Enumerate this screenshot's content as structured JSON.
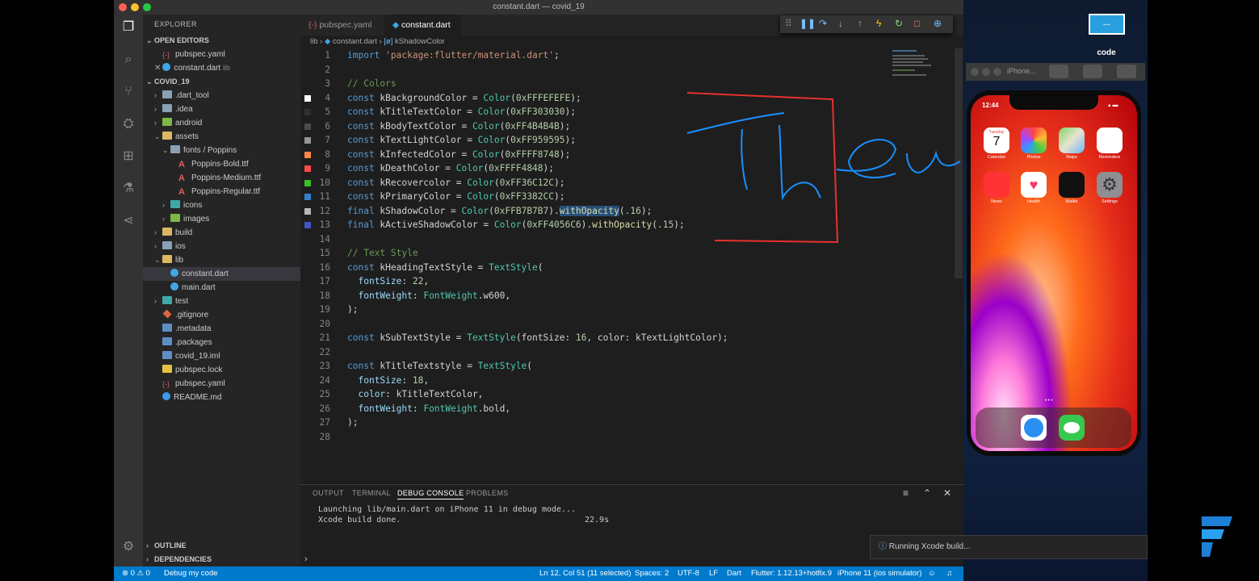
{
  "window": {
    "title": "constant.dart — covid_19"
  },
  "sidebar": {
    "explorer_label": "EXPLORER",
    "open_editors_label": "OPEN EDITORS",
    "open_editors": [
      {
        "name": "pubspec.yaml",
        "hint": ""
      },
      {
        "name": "constant.dart",
        "hint": "lib"
      }
    ],
    "project_label": "COVID_19",
    "tree": [
      {
        "label": ".dart_tool",
        "depth": 1,
        "kind": "folder",
        "twisty": "›"
      },
      {
        "label": ".idea",
        "depth": 1,
        "kind": "folder",
        "twisty": "›"
      },
      {
        "label": "android",
        "depth": 1,
        "kind": "folder green",
        "twisty": "›"
      },
      {
        "label": "assets",
        "depth": 1,
        "kind": "folder yellow",
        "twisty": "⌄"
      },
      {
        "label": "fonts / Poppins",
        "depth": 2,
        "kind": "folder",
        "twisty": "⌄"
      },
      {
        "label": "Poppins-Bold.ttf",
        "depth": 3,
        "kind": "font",
        "twisty": ""
      },
      {
        "label": "Poppins-Medium.ttf",
        "depth": 3,
        "kind": "font",
        "twisty": ""
      },
      {
        "label": "Poppins-Regular.ttf",
        "depth": 3,
        "kind": "font",
        "twisty": ""
      },
      {
        "label": "icons",
        "depth": 2,
        "kind": "folder teal",
        "twisty": "›"
      },
      {
        "label": "images",
        "depth": 2,
        "kind": "folder green",
        "twisty": "›"
      },
      {
        "label": "build",
        "depth": 1,
        "kind": "folder yellow",
        "twisty": "›"
      },
      {
        "label": "ios",
        "depth": 1,
        "kind": "folder",
        "twisty": "›"
      },
      {
        "label": "lib",
        "depth": 1,
        "kind": "folder yellow",
        "twisty": "⌄"
      },
      {
        "label": "constant.dart",
        "depth": 2,
        "kind": "dart",
        "twisty": "",
        "active": true
      },
      {
        "label": "main.dart",
        "depth": 2,
        "kind": "dart",
        "twisty": ""
      },
      {
        "label": "test",
        "depth": 1,
        "kind": "folder teal",
        "twisty": "›"
      },
      {
        "label": ".gitignore",
        "depth": 1,
        "kind": "git",
        "twisty": ""
      },
      {
        "label": ".metadata",
        "depth": 1,
        "kind": "file",
        "twisty": ""
      },
      {
        "label": ".packages",
        "depth": 1,
        "kind": "file",
        "twisty": ""
      },
      {
        "label": "covid_19.iml",
        "depth": 1,
        "kind": "file",
        "twisty": ""
      },
      {
        "label": "pubspec.lock",
        "depth": 1,
        "kind": "lock",
        "twisty": ""
      },
      {
        "label": "pubspec.yaml",
        "depth": 1,
        "kind": "yaml",
        "twisty": ""
      },
      {
        "label": "README.md",
        "depth": 1,
        "kind": "info",
        "twisty": ""
      }
    ],
    "outline_label": "OUTLINE",
    "dependencies_label": "DEPENDENCIES"
  },
  "tabs": [
    {
      "label": "pubspec.yaml",
      "active": false
    },
    {
      "label": "constant.dart",
      "active": true
    }
  ],
  "breadcrumb": {
    "folder": "lib",
    "file": "constant.dart",
    "symbol": "kShadowColor"
  },
  "editor": {
    "lines": [
      {
        "n": "1",
        "html": "<span class=\"kw\">import</span> <span class=\"str\">'package:flutter/material.dart'</span>;"
      },
      {
        "n": "2",
        "html": ""
      },
      {
        "n": "3",
        "html": "<span class=\"cm\">// Colors</span>"
      },
      {
        "n": "4",
        "swatch": "#FEFEFE",
        "html": "<span class=\"kw\">const</span> kBackgroundColor = <span class=\"ty\">Color</span>(<span class=\"num\">0xFFFEFEFE</span>);"
      },
      {
        "n": "5",
        "swatch": "#303030",
        "html": "<span class=\"kw\">const</span> kTitleTextColor = <span class=\"ty\">Color</span>(<span class=\"num\">0xFF303030</span>);"
      },
      {
        "n": "6",
        "swatch": "#4B4B4B",
        "html": "<span class=\"kw\">const</span> kBodyTextColor = <span class=\"ty\">Color</span>(<span class=\"num\">0xFF4B4B4B</span>);"
      },
      {
        "n": "7",
        "swatch": "#959595",
        "html": "<span class=\"kw\">const</span> kTextLightColor = <span class=\"ty\">Color</span>(<span class=\"num\">0xFF959595</span>);"
      },
      {
        "n": "8",
        "swatch": "#FF8748",
        "html": "<span class=\"kw\">const</span> kInfectedColor = <span class=\"ty\">Color</span>(<span class=\"num\">0xFFFF8748</span>);"
      },
      {
        "n": "9",
        "swatch": "#FF4848",
        "html": "<span class=\"kw\">const</span> kDeathColor = <span class=\"ty\">Color</span>(<span class=\"num\">0xFFFF4848</span>);"
      },
      {
        "n": "10",
        "swatch": "#36C12C",
        "html": "<span class=\"kw\">const</span> kRecovercolor = <span class=\"ty\">Color</span>(<span class=\"num\">0xFF36C12C</span>);"
      },
      {
        "n": "11",
        "swatch": "#3382CC",
        "html": "<span class=\"kw\">const</span> kPrimaryColor = <span class=\"ty\">Color</span>(<span class=\"num\">0xFF3382CC</span>);"
      },
      {
        "n": "12",
        "swatch": "#B7B7B7",
        "html": "<span class=\"kw\">final</span> kShadowColor = <span class=\"ty\">Color</span>(<span class=\"num\">0xFFB7B7B7</span>).<span class=\"fn sel\">withOpacity</span>(<span class=\"num\">.16</span>);"
      },
      {
        "n": "13",
        "swatch": "#4056C6",
        "html": "<span class=\"kw\">final</span> kActiveShadowColor = <span class=\"ty\">Color</span>(<span class=\"num\">0xFF4056C6</span>).<span class=\"fn\">withOpacity</span>(<span class=\"num\">.15</span>);"
      },
      {
        "n": "14",
        "html": ""
      },
      {
        "n": "15",
        "html": "<span class=\"cm\">// Text Style</span>"
      },
      {
        "n": "16",
        "html": "<span class=\"kw\">const</span> kHeadingTextStyle = <span class=\"ty\">TextStyle</span>("
      },
      {
        "n": "17",
        "html": "  <span class=\"var\">fontSize</span>: <span class=\"num\">22</span>,"
      },
      {
        "n": "18",
        "html": "  <span class=\"var\">fontWeight</span>: <span class=\"ty\">FontWeight</span>.w600,"
      },
      {
        "n": "19",
        "html": ");"
      },
      {
        "n": "20",
        "html": ""
      },
      {
        "n": "21",
        "html": "<span class=\"kw\">const</span> kSubTextStyle = <span class=\"ty\">TextStyle</span>(fontSize: <span class=\"num\">16</span>, color: kTextLightColor);"
      },
      {
        "n": "22",
        "html": ""
      },
      {
        "n": "23",
        "html": "<span class=\"kw\">const</span> kTitleTextstyle = <span class=\"ty\">TextStyle</span>("
      },
      {
        "n": "24",
        "html": "  <span class=\"var\">fontSize</span>: <span class=\"num\">18</span>,"
      },
      {
        "n": "25",
        "html": "  <span class=\"var\">color</span>: kTitleTextColor,"
      },
      {
        "n": "26",
        "html": "  <span class=\"var\">fontWeight</span>: <span class=\"ty\">FontWeight</span>.bold,"
      },
      {
        "n": "27",
        "html": ");"
      },
      {
        "n": "28",
        "html": ""
      }
    ]
  },
  "panel": {
    "tabs": [
      {
        "label": "OUTPUT",
        "active": false
      },
      {
        "label": "TERMINAL",
        "active": false
      },
      {
        "label": "DEBUG CONSOLE",
        "active": true
      },
      {
        "label": "PROBLEMS",
        "active": false
      }
    ],
    "console_line1": "Launching lib/main.dart on iPhone 11 in debug mode...",
    "console_line2": "Xcode build done.",
    "console_time": "22.9s",
    "prompt": "›",
    "notification": "Running Xcode build..."
  },
  "statusbar": {
    "problems": "⊗ 0 ⚠ 0",
    "debug": "Debug my code",
    "position": "Ln 12, Col 51 (11 selected)",
    "spaces": "Spaces: 2",
    "encoding": "UTF-8",
    "eol": "LF",
    "language": "Dart",
    "flutter": "Flutter: 1.12.13+hotfix.9",
    "device": "iPhone 11 (ios simulator)"
  },
  "desktop": {
    "icon_label": "code",
    "icon_text": "---"
  },
  "simulator": {
    "toolbar_title": "iPhone...",
    "time": "12:44",
    "calendar_day": "Tuesday",
    "calendar_date": "7",
    "apps": [
      "Calendar",
      "Photos",
      "Maps",
      "Reminders",
      "News",
      "Health",
      "Wallet",
      "Settings"
    ]
  },
  "colors": {
    "accent": "#007acc",
    "annotation_red": "#e8302c",
    "annotation_blue": "#1a8fff"
  }
}
